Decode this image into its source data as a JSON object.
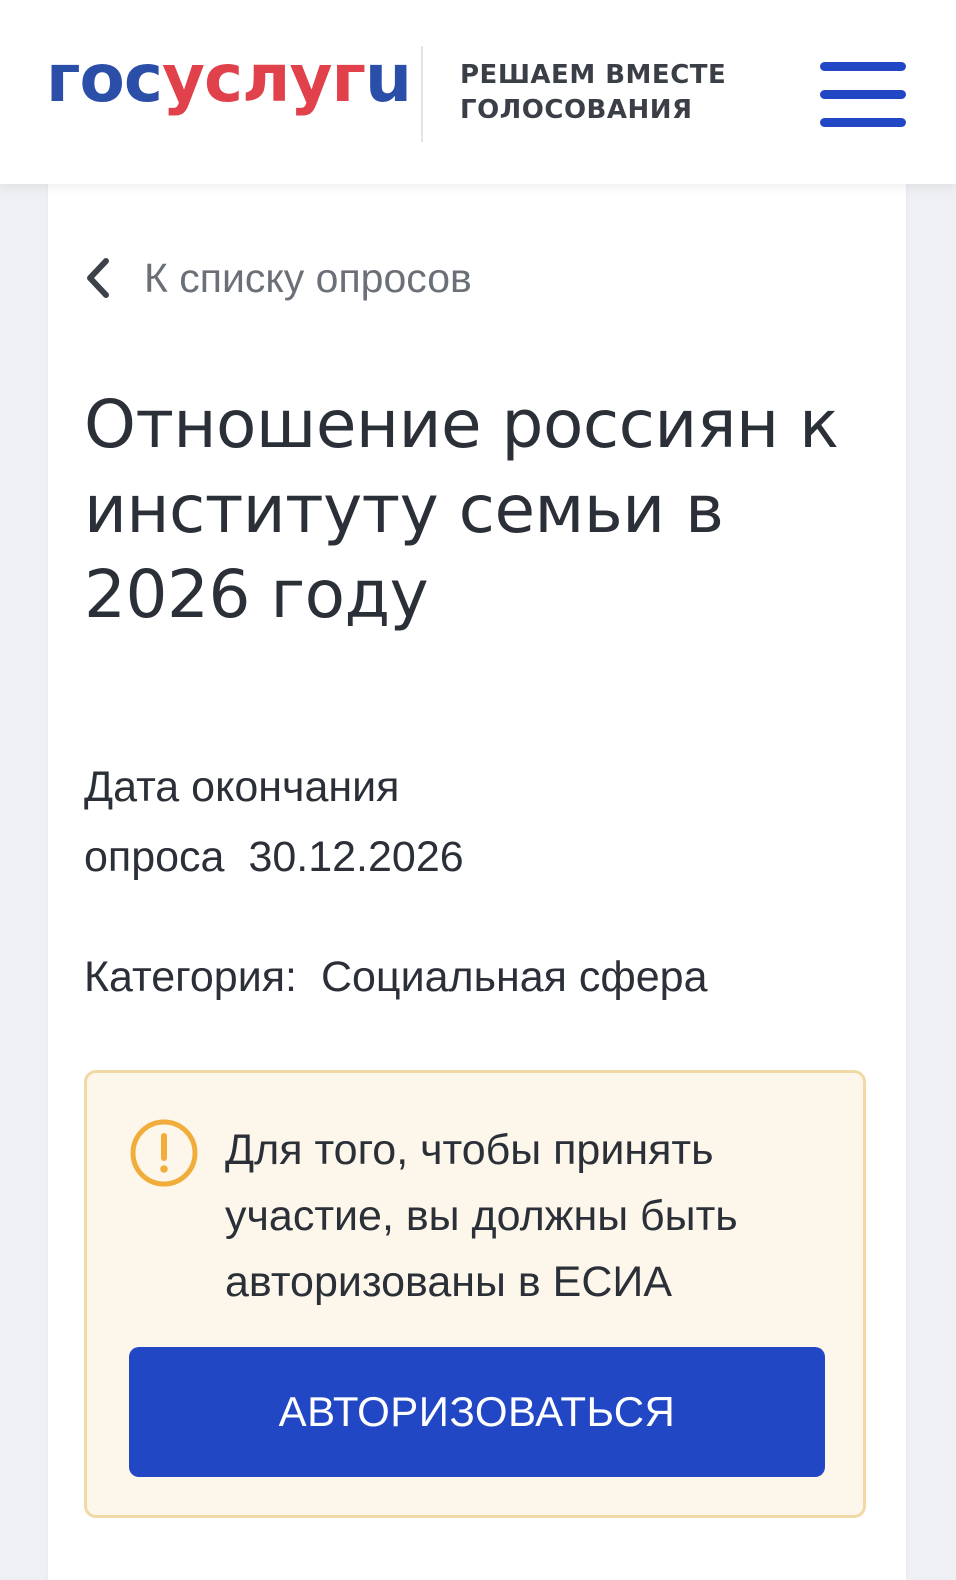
{
  "header": {
    "logo": {
      "part1": "гос",
      "part2": "услуг",
      "part3": "u",
      "colors": {
        "blue": "#2b4fa8",
        "red": "#e0414b"
      }
    },
    "tagline_line1": "РЕШАЕМ ВМЕСТЕ",
    "tagline_line2": "ГОЛОСОВАНИЯ",
    "menu_icon": "hamburger-menu-icon"
  },
  "main": {
    "back_link": {
      "icon": "chevron-left-icon",
      "label": "К списку опросов"
    },
    "title": "Отношение россиян к институту семьи в 2026 году",
    "end_date": {
      "label": "Дата окончания опроса",
      "value": "30.12.2026"
    },
    "category": {
      "label": "Категория:",
      "value": "Социальная сфера"
    },
    "notice": {
      "icon": "exclamation-circle-icon",
      "text": "Для того, чтобы принять участие, вы должны быть авторизованы в ЕСИА",
      "button_label": "АВТОРИЗОВАТЬСЯ"
    }
  },
  "colors": {
    "accent": "#2147c4",
    "notice_background": "#fcf7ea",
    "notice_border": "#f1d9a6",
    "notice_icon": "#f0ad3c"
  }
}
